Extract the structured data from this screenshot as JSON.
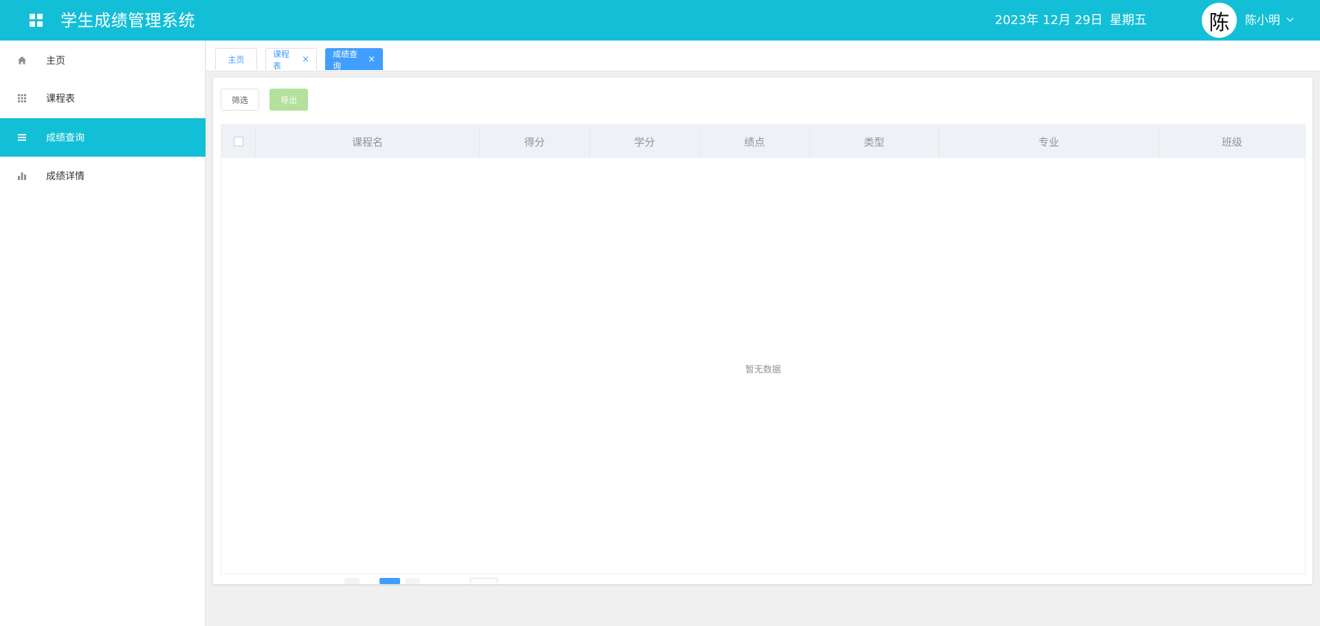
{
  "header": {
    "title": "学生成绩管理系统",
    "date": "2023年 12月 29日",
    "weekday": "星期五",
    "avatar_char": "陈",
    "username": "陈小明",
    "color": "#13bfd6"
  },
  "sidebar": {
    "items": [
      {
        "label": "主页",
        "icon": "home-icon"
      },
      {
        "label": "课程表",
        "icon": "grid-icon"
      },
      {
        "label": "成绩查询",
        "icon": "list-icon",
        "active": true
      },
      {
        "label": "成绩详情",
        "icon": "bar-chart-icon"
      }
    ]
  },
  "tabs": [
    {
      "label": "主页",
      "closable": false
    },
    {
      "label": "课程表",
      "closable": true,
      "close": "×"
    },
    {
      "label": "成绩查询",
      "closable": true,
      "close": "×",
      "active": true
    }
  ],
  "toolbar": {
    "filter_label": "筛选",
    "export_label": "导出"
  },
  "table": {
    "columns": [
      "课程名",
      "得分",
      "学分",
      "绩点",
      "类型",
      "专业",
      "班级"
    ],
    "rows": [],
    "empty_text": "暂无数据"
  },
  "colors": {
    "accent": "#13bfd6",
    "tab_active": "#409eff",
    "export_button": "#b3e19d"
  }
}
